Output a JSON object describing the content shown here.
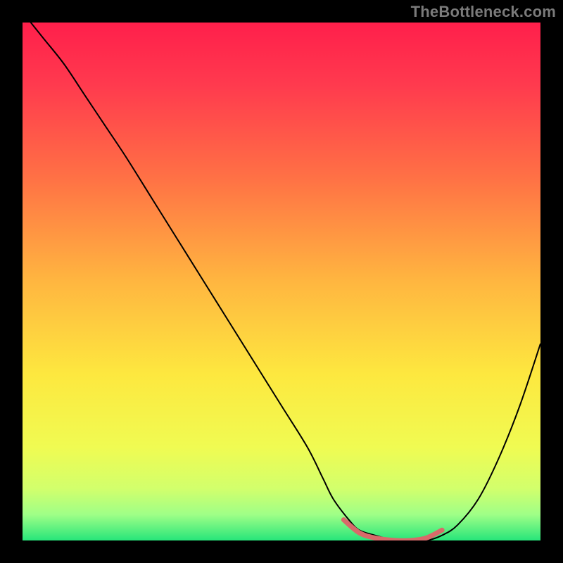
{
  "watermark": "TheBottleneck.com",
  "chart_data": {
    "type": "line",
    "title": "",
    "xlabel": "",
    "ylabel": "",
    "xlim": [
      0,
      100
    ],
    "ylim": [
      0,
      100
    ],
    "gradient": {
      "stops": [
        {
          "pos": 0.0,
          "color": "#ff1f4b"
        },
        {
          "pos": 0.12,
          "color": "#ff3a4e"
        },
        {
          "pos": 0.3,
          "color": "#ff7145"
        },
        {
          "pos": 0.5,
          "color": "#ffb640"
        },
        {
          "pos": 0.68,
          "color": "#fde83f"
        },
        {
          "pos": 0.82,
          "color": "#f0fb52"
        },
        {
          "pos": 0.9,
          "color": "#d2ff6c"
        },
        {
          "pos": 0.95,
          "color": "#9fff87"
        },
        {
          "pos": 1.0,
          "color": "#27e57a"
        }
      ]
    },
    "series": [
      {
        "name": "bottleneck-curve",
        "color": "#000000",
        "width": 2,
        "x": [
          0,
          4,
          8,
          12,
          16,
          20,
          25,
          30,
          35,
          40,
          45,
          50,
          55,
          58,
          60,
          63,
          65,
          68,
          72,
          75,
          78,
          81,
          84,
          88,
          92,
          96,
          100
        ],
        "y": [
          102,
          97,
          92,
          86,
          80,
          74,
          66,
          58,
          50,
          42,
          34,
          26,
          18,
          12,
          8,
          4,
          2,
          1,
          0,
          0,
          0,
          1,
          3,
          8,
          16,
          26,
          38
        ]
      },
      {
        "name": "optimal-range",
        "color": "#d86a6a",
        "width": 7,
        "cap": "round",
        "x": [
          62,
          65,
          68,
          72,
          75,
          78,
          81
        ],
        "y": [
          4,
          1.5,
          0.5,
          0,
          0,
          0.5,
          2
        ]
      }
    ]
  }
}
